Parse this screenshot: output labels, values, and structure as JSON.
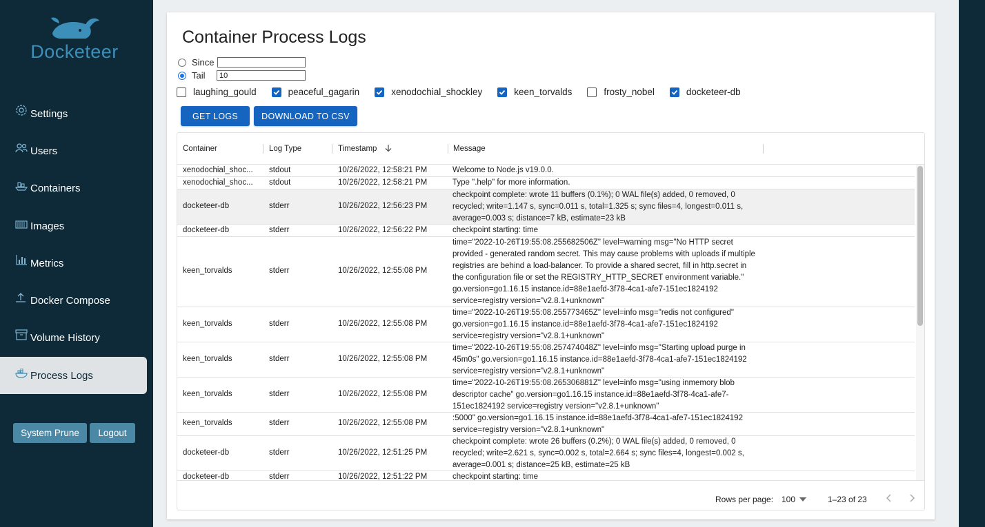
{
  "app": {
    "name": "Docketeer"
  },
  "sidebar": {
    "items": [
      {
        "label": "Settings",
        "icon": "gear-icon"
      },
      {
        "label": "Users",
        "icon": "users-icon"
      },
      {
        "label": "Containers",
        "icon": "ship-icon"
      },
      {
        "label": "Images",
        "icon": "container-icon"
      },
      {
        "label": "Metrics",
        "icon": "chart-icon"
      },
      {
        "label": "Docker Compose",
        "icon": "upload-icon"
      },
      {
        "label": "Volume History",
        "icon": "archive-icon"
      },
      {
        "label": "Process Logs",
        "icon": "docker-whale-icon",
        "active": true
      }
    ],
    "prune_label": "System Prune",
    "logout_label": "Logout"
  },
  "main": {
    "title": "Container Process Logs",
    "since_label": "Since",
    "since_value": "",
    "tail_label": "Tail",
    "tail_value": "10",
    "selected_option": "Tail",
    "containers": [
      {
        "name": "laughing_gould",
        "checked": false
      },
      {
        "name": "peaceful_gagarin",
        "checked": true
      },
      {
        "name": "xenodochial_shockley",
        "checked": true
      },
      {
        "name": "keen_torvalds",
        "checked": true
      },
      {
        "name": "frosty_nobel",
        "checked": false
      },
      {
        "name": "docketeer-db",
        "checked": true
      }
    ],
    "get_logs_label": "GET LOGS",
    "download_label": "DOWNLOAD TO CSV"
  },
  "table": {
    "headers": {
      "container": "Container",
      "logtype": "Log Type",
      "timestamp": "Timestamp",
      "message": "Message"
    },
    "sort_icon": "arrow-down-icon",
    "rows": [
      {
        "container": "xenodochial_shoc...",
        "logtype": "stdout",
        "timestamp": "10/26/2022, 12:58:21 PM",
        "message": "Welcome to Node.js v19.0.0."
      },
      {
        "container": "xenodochial_shoc...",
        "logtype": "stdout",
        "timestamp": "10/26/2022, 12:58:21 PM",
        "message": "Type \".help\" for more information."
      },
      {
        "container": "docketeer-db",
        "logtype": "stderr",
        "timestamp": "10/26/2022, 12:56:23 PM",
        "message": "checkpoint complete: wrote 11 buffers (0.1%); 0 WAL file(s) added, 0 removed, 0 recycled; write=1.147 s, sync=0.011 s, total=1.325 s; sync files=4, longest=0.011 s, average=0.003 s; distance=7 kB, estimate=23 kB"
      },
      {
        "container": "docketeer-db",
        "logtype": "stderr",
        "timestamp": "10/26/2022, 12:56:22 PM",
        "message": "checkpoint starting: time"
      },
      {
        "container": "keen_torvalds",
        "logtype": "stderr",
        "timestamp": "10/26/2022, 12:55:08 PM",
        "message": "time=\"2022-10-26T19:55:08.255682506Z\" level=warning msg=\"No HTTP secret provided - generated random secret. This may cause problems with uploads if multiple registries are behind a load-balancer. To provide a shared secret, fill in http.secret in the configuration file or set the REGISTRY_HTTP_SECRET environment variable.\" go.version=go1.16.15 instance.id=88e1aefd-3f78-4ca1-afe7-151ec1824192 service=registry version=\"v2.8.1+unknown\""
      },
      {
        "container": "keen_torvalds",
        "logtype": "stderr",
        "timestamp": "10/26/2022, 12:55:08 PM",
        "message": "time=\"2022-10-26T19:55:08.255773465Z\" level=info msg=\"redis not configured\" go.version=go1.16.15 instance.id=88e1aefd-3f78-4ca1-afe7-151ec1824192 service=registry version=\"v2.8.1+unknown\""
      },
      {
        "container": "keen_torvalds",
        "logtype": "stderr",
        "timestamp": "10/26/2022, 12:55:08 PM",
        "message": "time=\"2022-10-26T19:55:08.257474048Z\" level=info msg=\"Starting upload purge in 45m0s\" go.version=go1.16.15 instance.id=88e1aefd-3f78-4ca1-afe7-151ec1824192 service=registry version=\"v2.8.1+unknown\""
      },
      {
        "container": "keen_torvalds",
        "logtype": "stderr",
        "timestamp": "10/26/2022, 12:55:08 PM",
        "message": "time=\"2022-10-26T19:55:08.265306881Z\" level=info msg=\"using inmemory blob descriptor cache\" go.version=go1.16.15 instance.id=88e1aefd-3f78-4ca1-afe7-151ec1824192 service=registry version=\"v2.8.1+unknown\""
      },
      {
        "container": "keen_torvalds",
        "logtype": "stderr",
        "timestamp": "10/26/2022, 12:55:08 PM",
        "message": ":5000\" go.version=go1.16.15 instance.id=88e1aefd-3f78-4ca1-afe7-151ec1824192 service=registry version=\"v2.8.1+unknown\""
      },
      {
        "container": "docketeer-db",
        "logtype": "stderr",
        "timestamp": "10/26/2022, 12:51:25 PM",
        "message": "checkpoint complete: wrote 26 buffers (0.2%); 0 WAL file(s) added, 0 removed, 0 recycled; write=2.621 s, sync=0.002 s, total=2.664 s; sync files=4, longest=0.002 s, average=0.001 s; distance=25 kB, estimate=25 kB"
      },
      {
        "container": "docketeer-db",
        "logtype": "stderr",
        "timestamp": "10/26/2022, 12:51:22 PM",
        "message": "checkpoint starting: time"
      }
    ],
    "footer": {
      "rows_per_page_label": "Rows per page:",
      "rows_per_page_value": "100",
      "range_text": "1–23 of 23"
    }
  }
}
